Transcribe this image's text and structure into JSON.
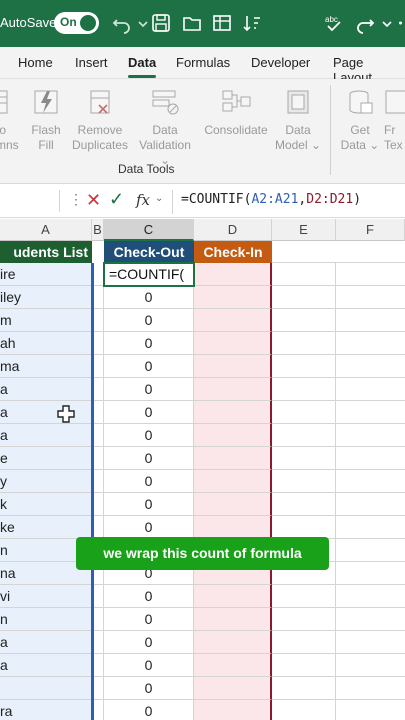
{
  "titlebar": {
    "autosave_label": "AutoSave",
    "toggle_state": "On",
    "icons": [
      "undo-icon",
      "save-icon",
      "folder-icon",
      "table-icon",
      "sort-icon",
      "spelling-icon",
      "redo-icon"
    ]
  },
  "tabs": [
    {
      "label": "Home"
    },
    {
      "label": "Insert"
    },
    {
      "label": "Data",
      "active": true
    },
    {
      "label": "Formulas"
    },
    {
      "label": "Developer"
    },
    {
      "label": "Page Layout"
    }
  ],
  "ribbon": {
    "items": [
      {
        "label": "to\nmns",
        "icon": "text-to-columns-icon"
      },
      {
        "label": "Flash\nFill",
        "icon": "flash-fill-icon"
      },
      {
        "label": "Remove\nDuplicates",
        "icon": "remove-duplicates-icon"
      },
      {
        "label": "Data\nValidation",
        "icon": "data-validation-icon"
      },
      {
        "label": "Consolidate",
        "icon": "consolidate-icon"
      },
      {
        "label": "Data\nModel",
        "icon": "data-model-icon"
      },
      {
        "label": "Get\nData",
        "icon": "get-data-icon"
      },
      {
        "label": "Fr\nTex",
        "icon": "from-text-icon"
      }
    ],
    "group_label": "Data Tools"
  },
  "formula_bar": {
    "fx": "fx",
    "formula_prefix": "=COUNTIF(",
    "ref_a": "A2:A21",
    "comma": ",",
    "ref_d": "D2:D21",
    "formula_suffix": ")"
  },
  "columns": [
    {
      "label": "A"
    },
    {
      "label": "B"
    },
    {
      "label": "C",
      "selected": true
    },
    {
      "label": "D"
    },
    {
      "label": "E"
    },
    {
      "label": "F"
    }
  ],
  "headers": {
    "a": "udents List",
    "c": "Check-Out",
    "d": "Check-In",
    "colors": {
      "a": "#1e5f32",
      "c": "#1f4e79",
      "d": "#c55a11"
    }
  },
  "rows": [
    {
      "a": "ire",
      "c": ""
    },
    {
      "a": "iley",
      "c": "0"
    },
    {
      "a": "m",
      "c": "0"
    },
    {
      "a": "ah",
      "c": "0"
    },
    {
      "a": "ma",
      "c": "0"
    },
    {
      "a": "a",
      "c": "0"
    },
    {
      "a": "a",
      "c": "0"
    },
    {
      "a": "a",
      "c": "0"
    },
    {
      "a": "e",
      "c": "0"
    },
    {
      "a": "y",
      "c": "0"
    },
    {
      "a": "k",
      "c": "0"
    },
    {
      "a": "ke",
      "c": "0"
    },
    {
      "a": "n",
      "c": "0"
    },
    {
      "a": "na",
      "c": "0"
    },
    {
      "a": "vi",
      "c": "0"
    },
    {
      "a": "n",
      "c": "0"
    },
    {
      "a": "a",
      "c": "0"
    },
    {
      "a": "a",
      "c": "0"
    },
    {
      "a": "",
      "c": "0"
    },
    {
      "a": "ra",
      "c": "0"
    }
  ],
  "active_cell": "=COUNTIF(",
  "caption": "we wrap this count of formula"
}
